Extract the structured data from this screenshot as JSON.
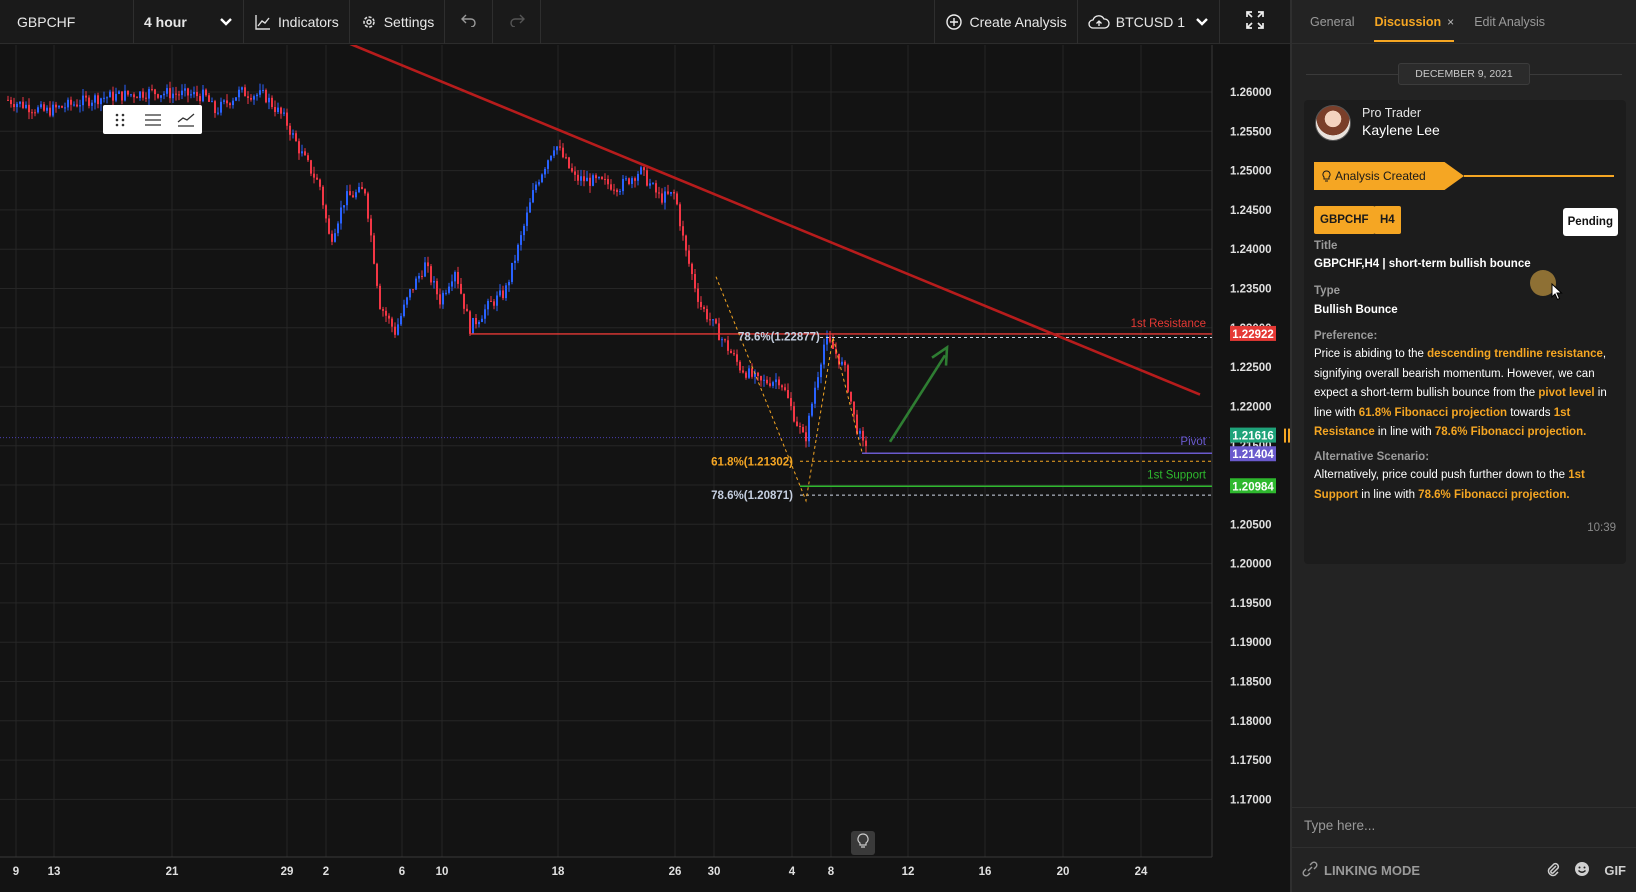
{
  "toolbar": {
    "symbol": "GBPCHF",
    "interval": "4 hour",
    "indicators_label": "Indicators",
    "settings_label": "Settings",
    "create_analysis_label": "Create Analysis",
    "compare_symbol": "BTCUSD 1"
  },
  "panel": {
    "tabs": [
      {
        "label": "General"
      },
      {
        "label": "Discussion",
        "close": "×"
      },
      {
        "label": "Edit Analysis"
      }
    ],
    "date_divider": "DECEMBER 9, 2021",
    "message": {
      "role": "Pro Trader",
      "name": "Kaylene Lee",
      "status": "Analysis Created",
      "tags": [
        "GBPCHF",
        "H4"
      ],
      "state": "Pending",
      "title_label": "Title",
      "title": "GBPCHF,H4 | short-term bullish bounce",
      "type_label": "Type",
      "type": "Bullish Bounce",
      "preference_label": "Preference:",
      "preference": [
        {
          "t": "Price is abiding to the "
        },
        {
          "t": "descending trendline resistance",
          "hl": true
        },
        {
          "t": ", signifying overall bearish momentum. However, we can expect a short-term bullish bounce from the "
        },
        {
          "t": "pivot level",
          "hl": true
        },
        {
          "t": " in line with "
        },
        {
          "t": "61.8% Fibonacci projection",
          "hl": true
        },
        {
          "t": " towards "
        },
        {
          "t": "1st Resistance",
          "hl": true
        },
        {
          "t": " in line with "
        },
        {
          "t": "78.6% Fibonacci projection.",
          "hl": true
        }
      ],
      "alt_label": "Alternative Scenario:",
      "alternative": [
        {
          "t": "Alternatively, price could push further down to the "
        },
        {
          "t": "1st Support",
          "hl": true
        },
        {
          "t": " in line with "
        },
        {
          "t": "78.6% Fibonacci projection.",
          "hl": true
        }
      ],
      "time": "10:39"
    },
    "compose_placeholder": "Type here...",
    "linking_mode": "LINKING MODE",
    "gif_label": "GIF"
  },
  "chart": {
    "y_ticks": [
      "1.26000",
      "1.25500",
      "1.25000",
      "1.24500",
      "1.24000",
      "1.23500",
      "1.23000",
      "1.22500",
      "1.22000",
      "1.21500",
      "1.21000",
      "1.20500",
      "1.20000",
      "1.19500",
      "1.19000",
      "1.18500",
      "1.18000",
      "1.17500",
      "1.17000"
    ],
    "x_ticks": [
      "9",
      "13",
      "21",
      "29",
      "2",
      "6",
      "10",
      "18",
      "26",
      "30",
      "4",
      "8",
      "12",
      "16",
      "20",
      "24"
    ],
    "levels": {
      "resistance": {
        "label": "1st Resistance",
        "value": "1.22922",
        "color": "#e53935"
      },
      "pivot": {
        "label": "Pivot",
        "value": "1.21404",
        "color": "#6a5acd"
      },
      "last_price": {
        "value": "1.21616",
        "color": "#1fa37a"
      },
      "support": {
        "label": "1st Support",
        "value": "1.20984",
        "color": "#2eb82e"
      }
    },
    "fib_labels": {
      "upper": "78.6%(1.22877)",
      "mid": "61.8%(1.21302)",
      "lower": "78.6%(1.20871)"
    },
    "colors": {
      "up": "#2962ff",
      "down": "#f23645",
      "trendline": "#b71c1c",
      "arrow": "#2e7d32",
      "fib": "#f5a623"
    }
  }
}
